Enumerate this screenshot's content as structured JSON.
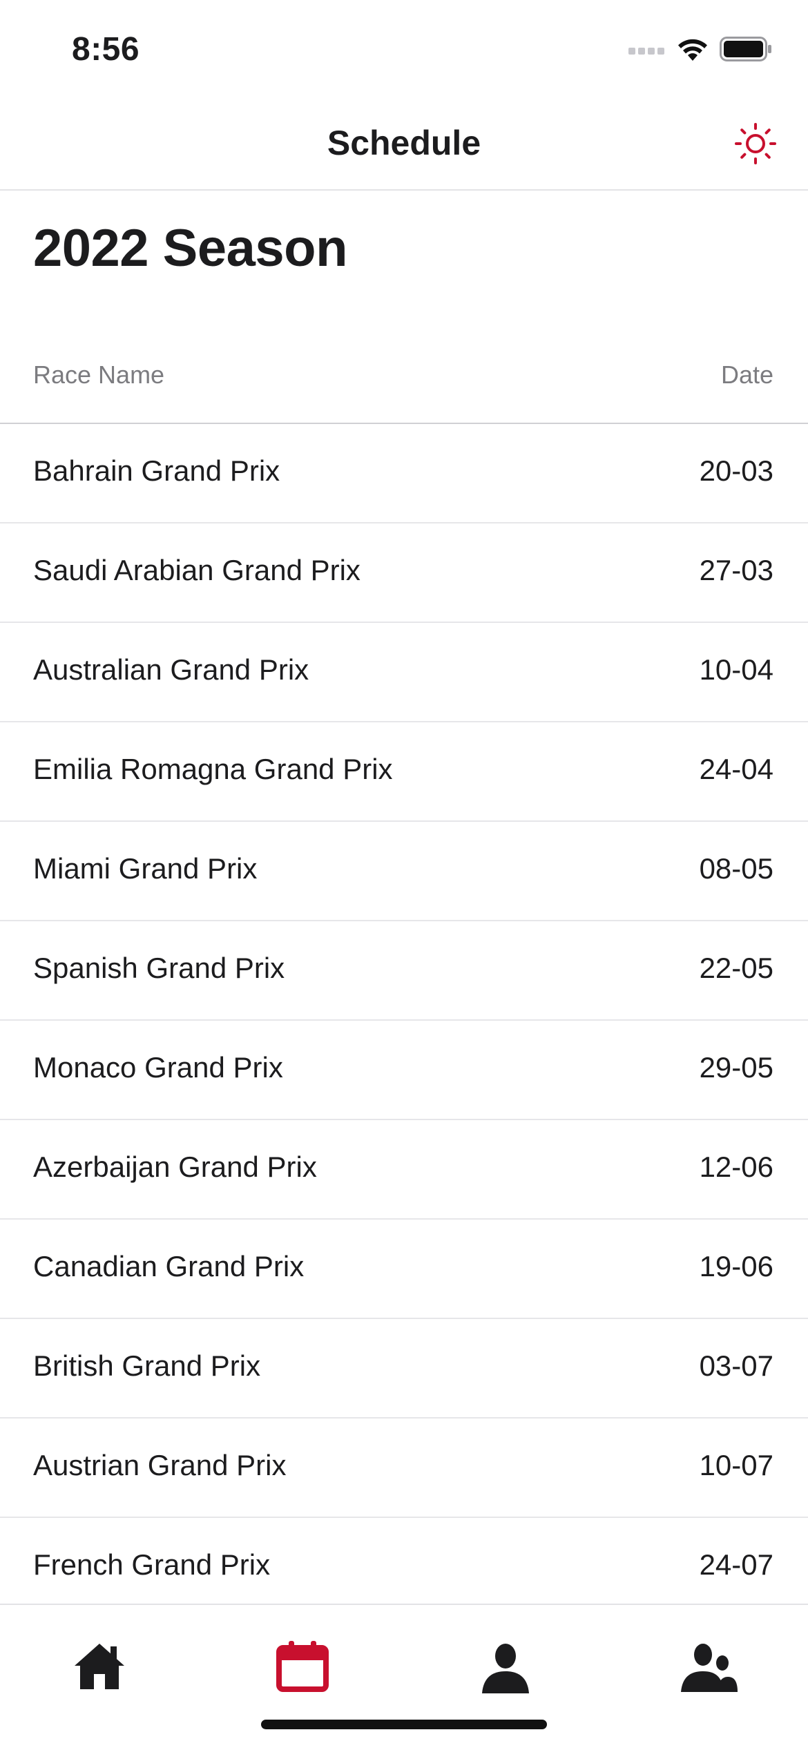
{
  "status_bar": {
    "time": "8:56"
  },
  "nav": {
    "title": "Schedule",
    "settings_icon": "sun-icon"
  },
  "season": {
    "title": "2022 Season"
  },
  "table": {
    "headers": {
      "name": "Race Name",
      "date": "Date"
    },
    "rows": [
      {
        "name": "Bahrain Grand Prix",
        "date": "20-03"
      },
      {
        "name": "Saudi Arabian Grand Prix",
        "date": "27-03"
      },
      {
        "name": "Australian Grand Prix",
        "date": "10-04"
      },
      {
        "name": "Emilia Romagna Grand Prix",
        "date": "24-04"
      },
      {
        "name": "Miami Grand Prix",
        "date": "08-05"
      },
      {
        "name": "Spanish Grand Prix",
        "date": "22-05"
      },
      {
        "name": "Monaco Grand Prix",
        "date": "29-05"
      },
      {
        "name": "Azerbaijan Grand Prix",
        "date": "12-06"
      },
      {
        "name": "Canadian Grand Prix",
        "date": "19-06"
      },
      {
        "name": "British Grand Prix",
        "date": "03-07"
      },
      {
        "name": "Austrian Grand Prix",
        "date": "10-07"
      },
      {
        "name": "French Grand Prix",
        "date": "24-07"
      }
    ]
  },
  "tab_bar": {
    "tabs": [
      {
        "icon": "home-icon",
        "active": false
      },
      {
        "icon": "calendar-icon",
        "active": true
      },
      {
        "icon": "driver-icon",
        "active": false
      },
      {
        "icon": "team-icon",
        "active": false
      }
    ]
  },
  "colors": {
    "accent": "#c8102e",
    "text": "#1c1c1e",
    "secondary_text": "#7c7c80",
    "separator": "#e6e6e9"
  }
}
